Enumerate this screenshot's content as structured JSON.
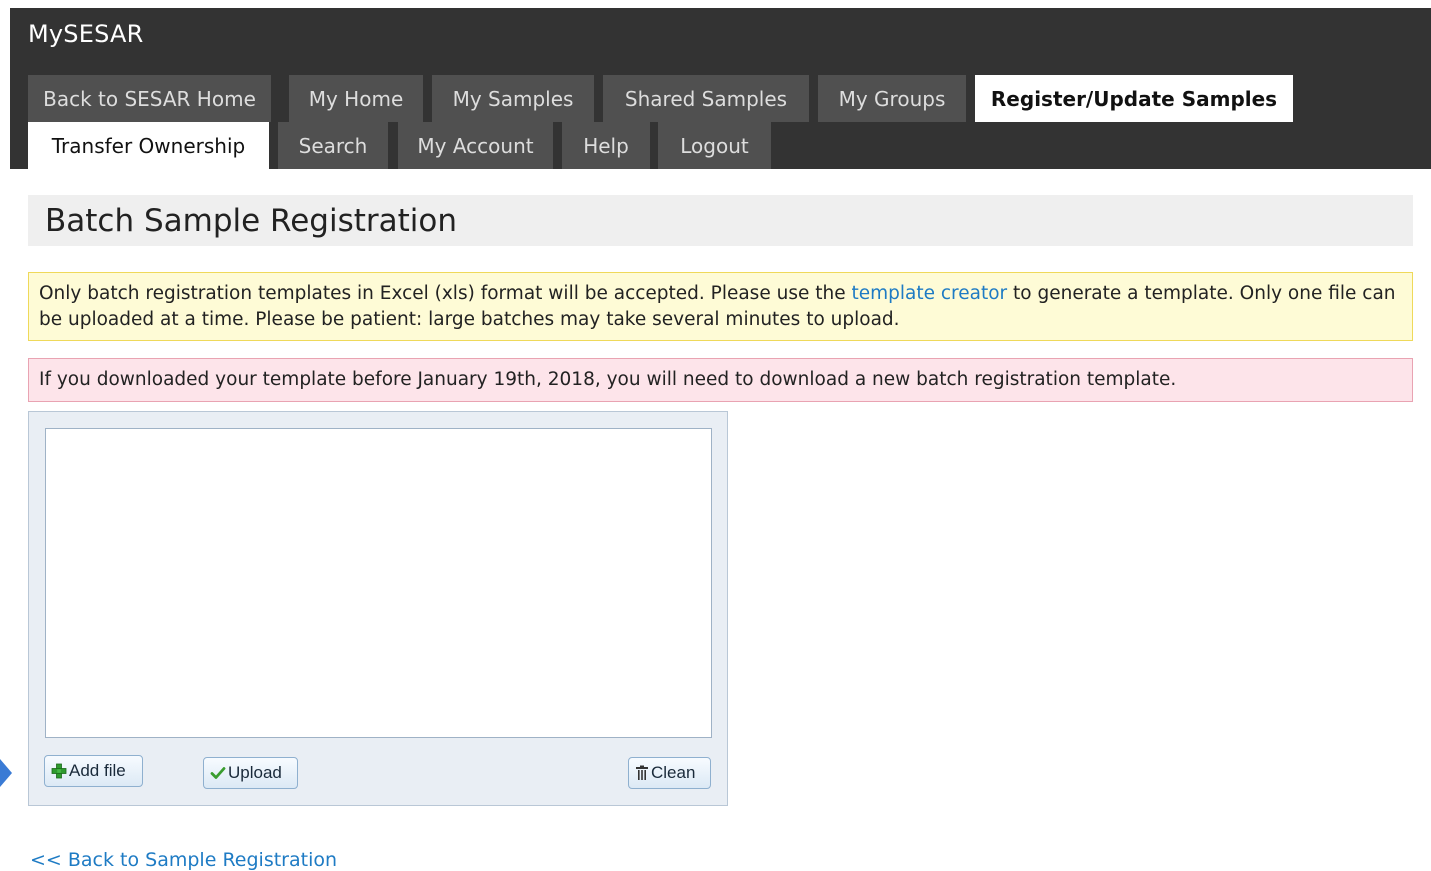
{
  "app": {
    "title": "MySESAR"
  },
  "nav": {
    "tabs": [
      {
        "label": "Back to SESAR Home"
      },
      {
        "label": "My Home"
      },
      {
        "label": "My Samples"
      },
      {
        "label": "Shared Samples"
      },
      {
        "label": "My Groups"
      },
      {
        "label": "Register/Update Samples"
      },
      {
        "label": "Transfer Ownership"
      },
      {
        "label": "Search"
      },
      {
        "label": "My Account"
      },
      {
        "label": "Help"
      },
      {
        "label": "Logout"
      }
    ]
  },
  "page": {
    "title": "Batch Sample Registration"
  },
  "notices": {
    "info_before": "Only batch registration templates in Excel (xls) format will be accepted. Please use the ",
    "info_link": "template creator",
    "info_after": " to generate a template. Only one file can be uploaded at a time. Please be patient: large batches may take several minutes to upload.",
    "warning": "If you downloaded your template before January 19th, 2018, you will need to download a new batch registration template."
  },
  "uploader": {
    "add_label": "Add file",
    "upload_label": "Upload",
    "clean_label": "Clean",
    "icons": {
      "add": "plus-icon",
      "upload": "check-icon",
      "clean": "trash-icon"
    }
  },
  "footer": {
    "back_link": "<< Back to Sample Registration"
  },
  "colors": {
    "header_bg": "#333333",
    "tab_bg": "#505050",
    "active_tab_bg": "#ffffff",
    "link": "#1e7bc4",
    "notice_yellow": "#fefbd6",
    "notice_pink": "#fde4ea"
  }
}
